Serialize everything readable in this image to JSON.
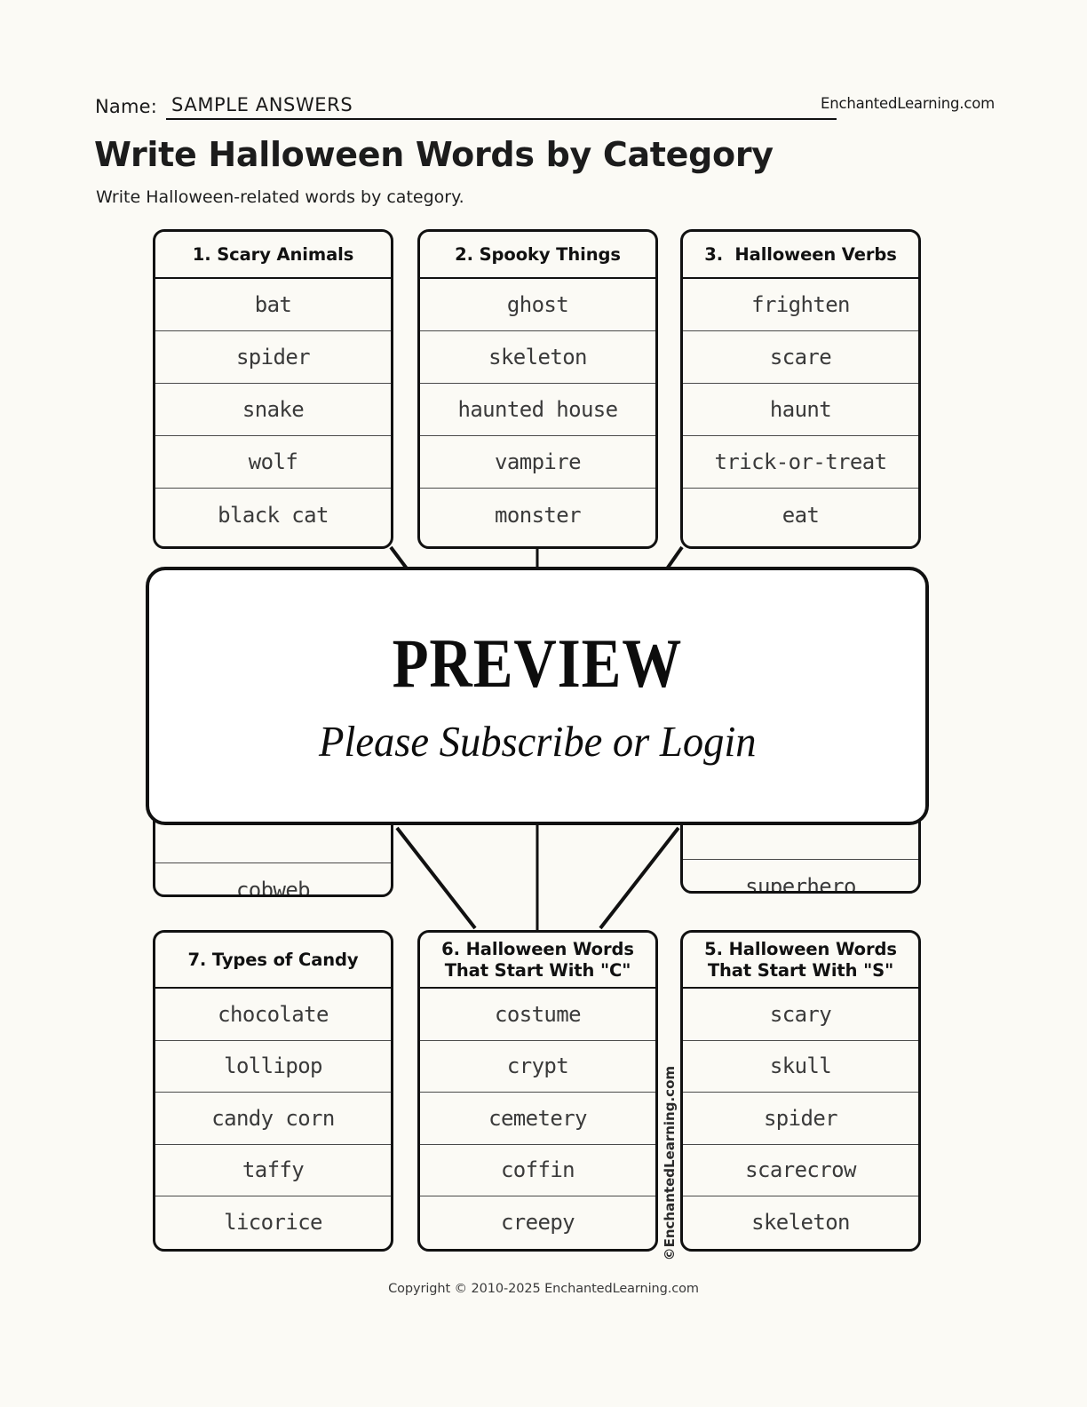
{
  "header": {
    "name_label": "Name:",
    "name_value": "SAMPLE ANSWERS",
    "brand": "EnchantedLearning.com",
    "title": "Write Halloween Words by Category",
    "subtitle": "Write Halloween-related words by category."
  },
  "boxes": {
    "b1": {
      "heading": "1. Scary Animals",
      "words": [
        "bat",
        "spider",
        "snake",
        "wolf",
        "black cat"
      ]
    },
    "b2": {
      "heading": "2. Spooky Things",
      "words": [
        "ghost",
        "skeleton",
        "haunted house",
        "vampire",
        "monster"
      ]
    },
    "b3": {
      "heading": "3.  Halloween Verbs",
      "words": [
        "frighten",
        "scare",
        "haunt",
        "trick-or-treat",
        "eat"
      ]
    },
    "b8": {
      "words": [
        "cobweb"
      ]
    },
    "b4": {
      "words": [
        "superhero"
      ]
    },
    "b7": {
      "heading": "7. Types of Candy",
      "words": [
        "chocolate",
        "lollipop",
        "candy corn",
        "taffy",
        "licorice"
      ]
    },
    "b6": {
      "heading": "6. Halloween Words\nThat Start With \"C\"",
      "words": [
        "costume",
        "crypt",
        "cemetery",
        "coffin",
        "creepy"
      ]
    },
    "b5": {
      "heading": "5.  Halloween Words\nThat Start With \"S\"",
      "words": [
        "scary",
        "skull",
        "spider",
        "scarecrow",
        "skeleton"
      ]
    }
  },
  "overlay": {
    "title": "PREVIEW",
    "subtitle": "Please Subscribe or Login"
  },
  "watermark": "©EnchantedLearning.com",
  "footer": "Copyright © 2010-2025 EnchantedLearning.com",
  "colors": {
    "page_background": "#fbfaf5",
    "ink": "#111111",
    "word_text": "#3a3a3a",
    "overlay_background": "#ffffff"
  }
}
